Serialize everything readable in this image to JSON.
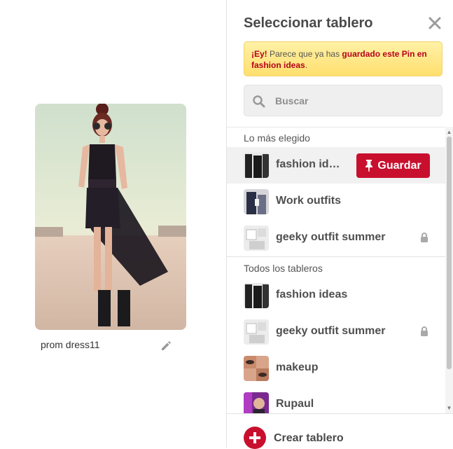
{
  "pin": {
    "description": "prom dress11",
    "image_icon": "fashion-photo",
    "edit_icon": "pencil-icon"
  },
  "panel": {
    "title": "Seleccionar tablero",
    "close_icon": "close-icon",
    "notice": {
      "prefix": "¡Ey!",
      "middle": " Parece que ya has ",
      "highlight1": "guardado este Pin en",
      "highlight2": "fashion ideas",
      "suffix": "."
    },
    "search": {
      "placeholder": "Buscar"
    },
    "sections": [
      {
        "label": "Lo más elegido",
        "boards": [
          {
            "name": "fashion id…",
            "locked": false,
            "hover": true
          },
          {
            "name": "Work outfits",
            "locked": false
          },
          {
            "name": "geeky outfit summer",
            "locked": true
          }
        ]
      },
      {
        "label": "Todos los tableros",
        "boards": [
          {
            "name": "fashion ideas",
            "locked": false
          },
          {
            "name": "geeky outfit summer",
            "locked": true
          },
          {
            "name": "makeup",
            "locked": false
          },
          {
            "name": "Rupaul",
            "locked": false
          }
        ]
      }
    ],
    "save_button": {
      "label": "Guardar",
      "icon": "pushpin-icon"
    },
    "create_board": {
      "label": "Crear tablero",
      "icon": "plus-circle-icon"
    }
  },
  "colors": {
    "accent_red": "#c8102e",
    "notice_bg": "#ffe98a",
    "notice_highlight": "#b5001b"
  }
}
